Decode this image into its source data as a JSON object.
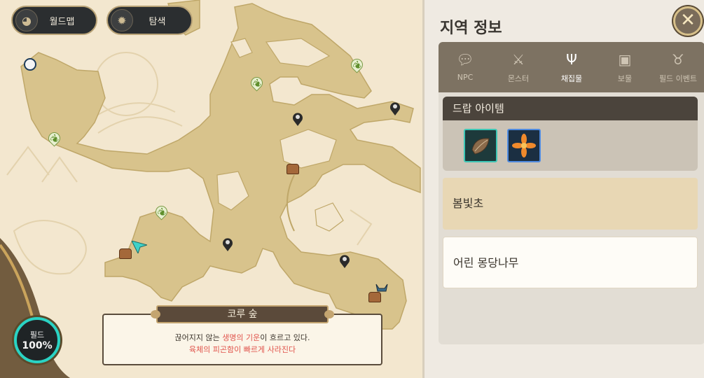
{
  "top_buttons": {
    "worldmap_label": "월드맵",
    "explore_label": "탐색"
  },
  "field_gauge": {
    "label": "필드",
    "value": "100%"
  },
  "region": {
    "name": "코루 숲",
    "desc_line1_a": "끊어지지 않는 ",
    "desc_line1_hl": "생명의 기운",
    "desc_line1_b": "이 흐르고 있다.",
    "desc_line2": "육체의 피곤함이 빠르게 사라진다"
  },
  "panel": {
    "title": "지역 정보",
    "close_icon": "close-icon",
    "tabs": [
      {
        "label": "NPC",
        "icon": "speech-bubble-icon"
      },
      {
        "label": "몬스터",
        "icon": "crossed-swords-icon"
      },
      {
        "label": "채집물",
        "icon": "sprout-icon"
      },
      {
        "label": "보물",
        "icon": "chest-icon"
      },
      {
        "label": "필드 이벤트",
        "icon": "horned-helmet-icon"
      }
    ],
    "active_tab": "채집물",
    "drop_header": "드랍 아이템",
    "drop_items": [
      {
        "icon": "seed-icon",
        "border": "#3ec7b6"
      },
      {
        "icon": "flower-icon",
        "border": "#4f8be0"
      }
    ],
    "entries": [
      {
        "label": "봄빛초",
        "selected": true
      },
      {
        "label": "어린 몽당나무",
        "selected": false
      }
    ]
  },
  "colors": {
    "accent_teal": "#2ad3c4",
    "highlight_red": "#e1554d",
    "map_land": "#d9c48e"
  }
}
